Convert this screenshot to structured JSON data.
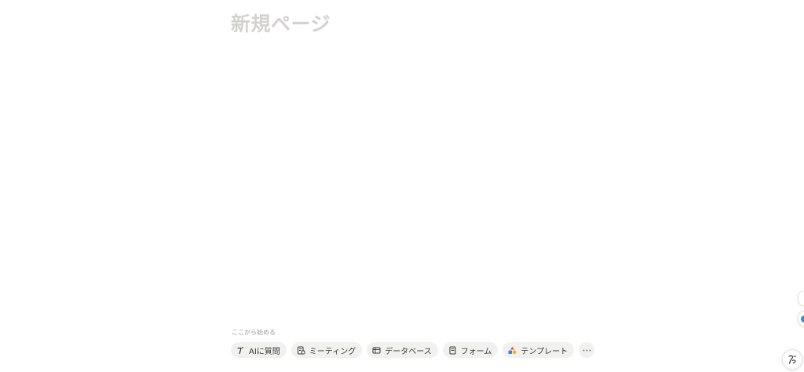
{
  "page": {
    "title_placeholder": "新規ページ"
  },
  "start": {
    "label": "ここから始める"
  },
  "chips": [
    {
      "label": "AIに質問",
      "icon": "ai-sparkle-icon"
    },
    {
      "label": "ミーティング",
      "icon": "meeting-notes-icon"
    },
    {
      "label": "データベース",
      "icon": "database-table-icon"
    },
    {
      "label": "フォーム",
      "icon": "form-icon"
    },
    {
      "label": "テンプレート",
      "icon": "template-icon"
    }
  ],
  "more": {
    "icon": "more-horizontal-icon"
  },
  "help": {
    "icon": "ai-assistant-icon"
  },
  "colors": {
    "title_placeholder": "#d3d2cf",
    "chip_background": "#f1f1ef",
    "accent_blue": "#2f8ae0"
  }
}
